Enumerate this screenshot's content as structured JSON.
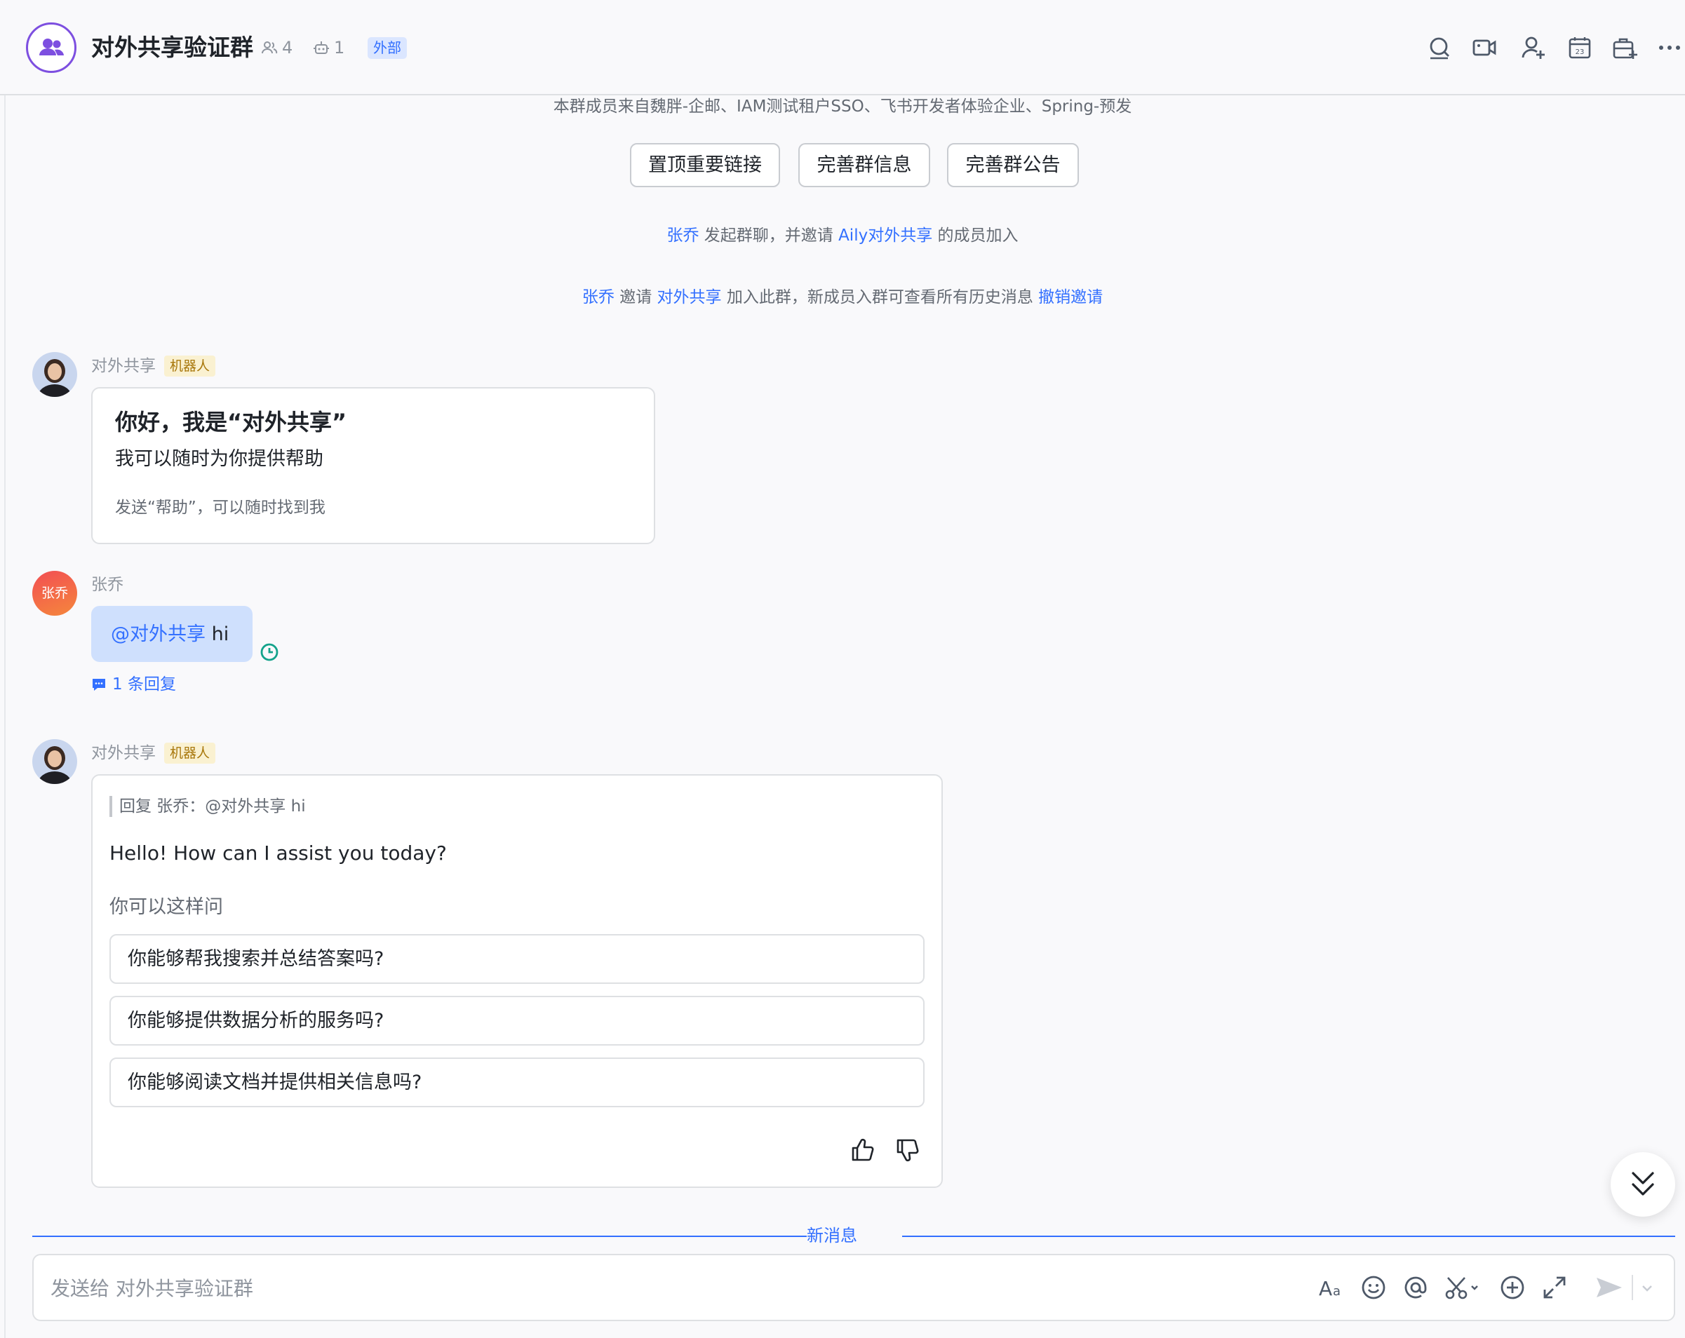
{
  "header": {
    "title": "对外共享验证群",
    "member_count": "4",
    "bot_count": "1",
    "external_badge": "外部"
  },
  "system": {
    "members_note": "本群成员来自魏胖-企邮、IAM测试租户SSO、飞书开发者体验企业、Spring-预发",
    "buttons": [
      "置顶重要链接",
      "完善群信息",
      "完善群公告"
    ],
    "line1": {
      "user": "张乔",
      "text_a": "发起群聊，并邀请",
      "group": "Aily对外共享",
      "text_b": "的成员加入"
    },
    "line2": {
      "user": "张乔",
      "text_a": "邀请",
      "invitee": "对外共享",
      "text_b": "加入此群，新成员入群可查看所有历史消息",
      "revoke": "撤销邀请"
    }
  },
  "messages": {
    "bot_name": "对外共享",
    "bot_tag": "机器人",
    "welcome": {
      "title": "你好，我是“对外共享”",
      "subtitle": "我可以随时为你提供帮助",
      "hint": "发送“帮助”，可以随时找到我"
    },
    "user": {
      "name": "张乔",
      "avatar_text": "张乔",
      "mention": "@对外共享",
      "text": "hi",
      "replies": "1 条回复"
    },
    "reply": {
      "quote": "回复 张乔：@对外共享 hi",
      "text": "Hello! How can I assist you today?",
      "suggest_label": "你可以这样问",
      "suggestions": [
        "你能够帮我搜索并总结答案吗?",
        "你能够提供数据分析的服务吗?",
        "你能够阅读文档并提供相关信息吗?"
      ]
    }
  },
  "divider": {
    "label": "新消息"
  },
  "composer": {
    "placeholder": "发送给 对外共享验证群"
  },
  "colors": {
    "accent": "#3370ff",
    "group_avatar": "#7d4fe0",
    "bot_tag_bg": "#faf1d1",
    "user_avatar": "#f26b3a"
  }
}
